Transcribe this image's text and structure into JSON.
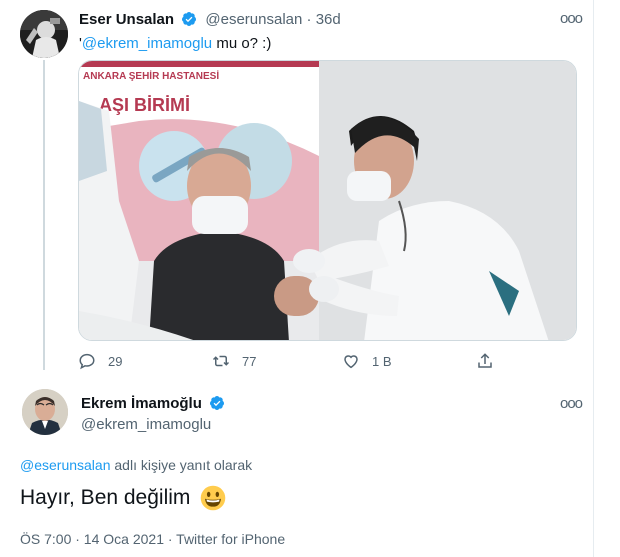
{
  "tweet1": {
    "name": "Eser Unsalan",
    "handle": "@eserunsalan",
    "separator": "·",
    "age": "36d",
    "more_label": "ooo",
    "quote_open": "'",
    "mention": "@ekrem_imamoglu",
    "text_rest": " mu o? :)",
    "photo": {
      "sign_line1": "ANKARA ŞEHİR HASTANESİ",
      "sign_line2": "AŞI BİRİMİ"
    },
    "actions": {
      "replies": "29",
      "retweets": "77",
      "likes": "1 B"
    }
  },
  "tweet2": {
    "name": "Ekrem İmamoğlu",
    "handle": "@ekrem_imamoglu",
    "more_label": "ooo",
    "reply_mention": "@eserunsalan",
    "reply_suffix": " adlı kişiye yanıt olarak",
    "text": "Hayır, Ben değilim",
    "emoji": "grinning-face-emoji",
    "meta": "ÖS 7:00 · 14 Oca 2021 · Twitter for iPhone"
  },
  "colors": {
    "accent": "#1d9bf0",
    "muted": "#536471",
    "border": "#cfd9de",
    "text": "#0f1419"
  }
}
